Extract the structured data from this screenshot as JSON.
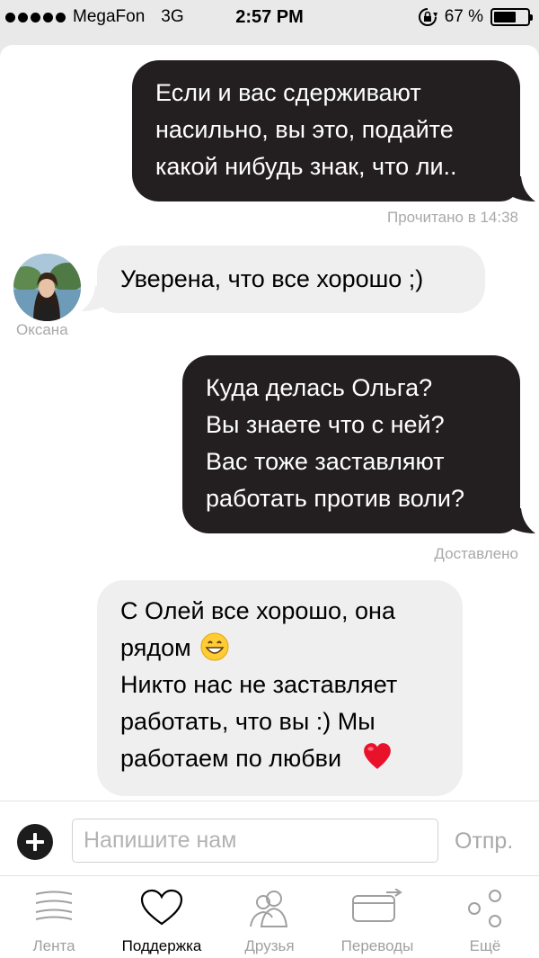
{
  "status_bar": {
    "carrier": "MegaFon",
    "network": "3G",
    "time": "2:57 PM",
    "battery_percent": "67 %",
    "battery_level": 0.67
  },
  "messages": [
    {
      "direction": "outgoing",
      "lines": [
        "Если и вас сдерживают",
        "насильно, вы это, подайте",
        "какой нибудь знак, что ли.."
      ],
      "status": "Прочитано в 14:38"
    },
    {
      "direction": "incoming",
      "sender": "Оксана",
      "lines": [
        "Уверена, что все хорошо ;)"
      ]
    },
    {
      "direction": "outgoing",
      "lines": [
        "Куда делась Ольга?",
        "Вы знаете что с ней?",
        "Вас тоже заставляют",
        "работать против воли?"
      ],
      "status": "Доставлено"
    },
    {
      "direction": "incoming",
      "lines": [
        "С Олей все хорошо, она",
        "рядом",
        "Никто нас не заставляет",
        "работать, что вы :) Мы",
        "работаем по любви"
      ],
      "emoji_icons": [
        "grinning-face-icon",
        "red-heart-icon"
      ]
    }
  ],
  "composer": {
    "placeholder": "Напишите нам",
    "send_label": "Отпр."
  },
  "tabs": [
    {
      "label": "Лента",
      "icon": "feed-icon",
      "active": false
    },
    {
      "label": "Поддержка",
      "icon": "heart-icon",
      "active": true
    },
    {
      "label": "Друзья",
      "icon": "friends-icon",
      "active": false
    },
    {
      "label": "Переводы",
      "icon": "transfers-icon",
      "active": false
    },
    {
      "label": "Ещё",
      "icon": "more-icon",
      "active": false
    }
  ],
  "colors": {
    "outgoing_bubble": "#231f20",
    "incoming_bubble": "#efefef",
    "meta_text": "#a9a9a9",
    "screen_background": "#e9e9e9"
  }
}
